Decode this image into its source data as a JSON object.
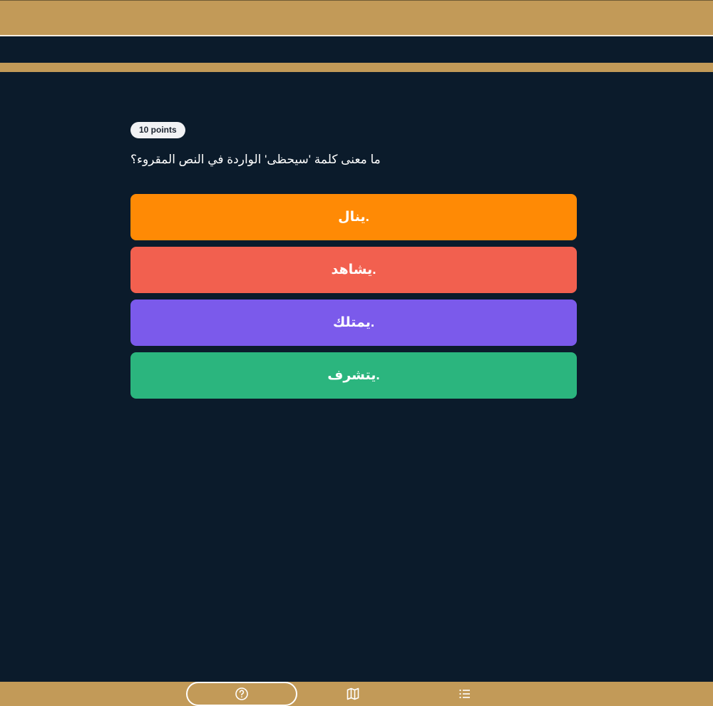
{
  "progress": {
    "fraction": 1.0,
    "colors": {
      "track": "#34465a",
      "fill": "#c29a58"
    }
  },
  "question": {
    "points_label": "10 points",
    "text": "ما معنى كلمة 'سيحظى' الواردة في النص المقروء؟"
  },
  "answers": [
    {
      "label": "ينال.",
      "color": "#ff8a05"
    },
    {
      "label": "يشاهد.",
      "color": "#f2604f"
    },
    {
      "label": "يمتلك.",
      "color": "#7b5aeb"
    },
    {
      "label": "يتشرف.",
      "color": "#2bb57e"
    }
  ],
  "bottom_nav": {
    "items": [
      {
        "icon": "help-circle-icon"
      },
      {
        "icon": "map-icon"
      },
      {
        "icon": "list-icon"
      }
    ]
  },
  "colors": {
    "background": "#0b1b2b",
    "bars": "#c29a58"
  }
}
